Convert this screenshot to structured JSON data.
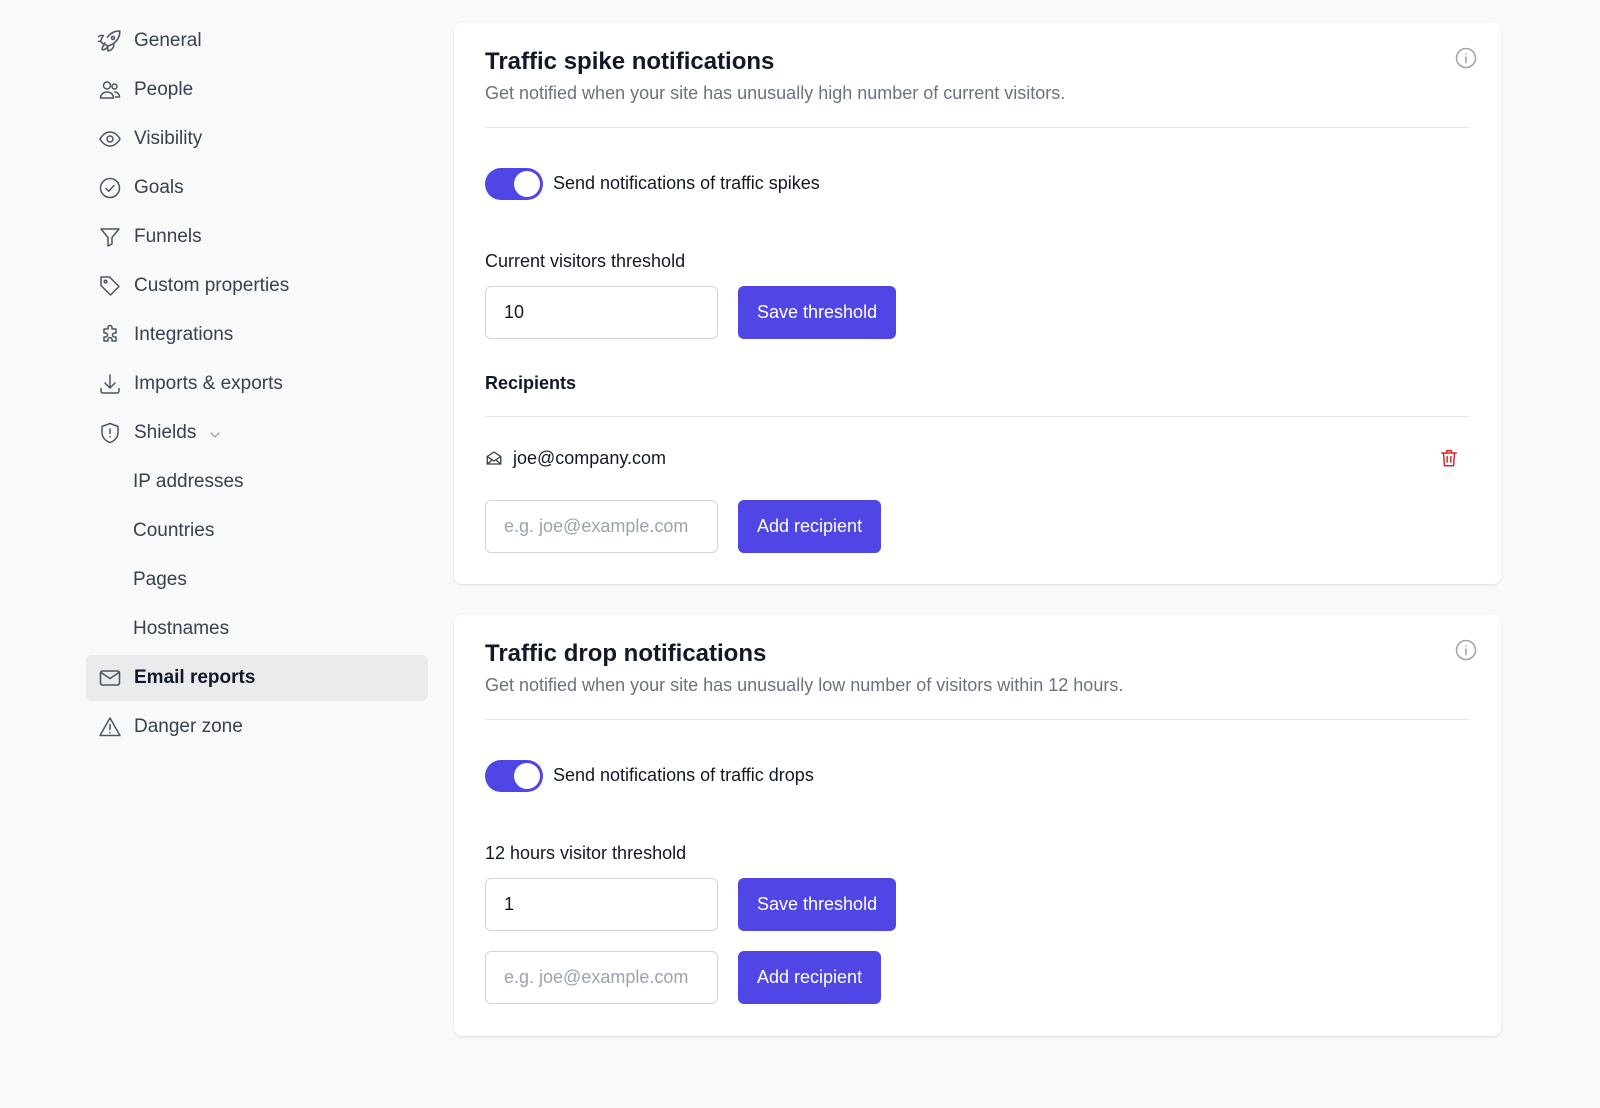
{
  "sidebar": {
    "items": [
      {
        "label": "General",
        "icon": "rocket-icon"
      },
      {
        "label": "People",
        "icon": "users-icon"
      },
      {
        "label": "Visibility",
        "icon": "eye-icon"
      },
      {
        "label": "Goals",
        "icon": "check-circle-icon"
      },
      {
        "label": "Funnels",
        "icon": "funnel-icon"
      },
      {
        "label": "Custom properties",
        "icon": "tag-icon"
      },
      {
        "label": "Integrations",
        "icon": "puzzle-icon"
      },
      {
        "label": "Imports & exports",
        "icon": "download-icon"
      },
      {
        "label": "Shields",
        "icon": "shield-icon",
        "expanded": true
      },
      {
        "label": "IP addresses"
      },
      {
        "label": "Countries"
      },
      {
        "label": "Pages"
      },
      {
        "label": "Hostnames"
      },
      {
        "label": "Email reports",
        "icon": "envelope-icon",
        "active": true
      },
      {
        "label": "Danger zone",
        "icon": "warning-icon"
      }
    ]
  },
  "spike": {
    "title": "Traffic spike notifications",
    "description": "Get notified when your site has unusually high number of current visitors.",
    "toggle_label": "Send notifications of traffic spikes",
    "toggle_on": true,
    "threshold_label": "Current visitors threshold",
    "threshold_value": "10",
    "save_label": "Save threshold",
    "recipients_label": "Recipients",
    "recipients": [
      "joe@company.com"
    ],
    "recipient_placeholder": "e.g. joe@example.com",
    "add_label": "Add recipient"
  },
  "drop": {
    "title": "Traffic drop notifications",
    "description": "Get notified when your site has unusually low number of visitors within 12 hours.",
    "toggle_label": "Send notifications of traffic drops",
    "toggle_on": true,
    "threshold_label": "12 hours visitor threshold",
    "threshold_value": "1",
    "save_label": "Save threshold",
    "recipient_placeholder": "e.g. joe@example.com",
    "add_label": "Add recipient"
  },
  "colors": {
    "accent": "#4f46e5",
    "danger": "#dc2626",
    "active_bg": "#ebebed"
  }
}
